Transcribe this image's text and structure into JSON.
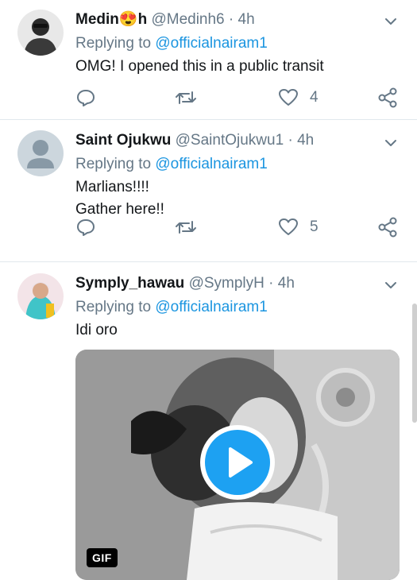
{
  "tweets": [
    {
      "name": "Medin",
      "name_suffix": "h",
      "name_emoji": "😍",
      "handle": "@Medinh6",
      "time": "4h",
      "replying_label": "Replying to",
      "replying_to": "@officialnairam1",
      "text": "OMG! I opened this in a public transit",
      "likes": "4"
    },
    {
      "name": "Saint Ojukwu",
      "handle": "@SaintOjukwu1",
      "time": "4h",
      "replying_label": "Replying to",
      "replying_to": "@officialnairam1",
      "text_line1": "Marlians!!!!",
      "text_line2": "Gather here!!",
      "likes": "5"
    },
    {
      "name": "Symply_hawau",
      "handle": "@SymplyH",
      "time": "4h",
      "replying_label": "Replying to",
      "replying_to": "@officialnairam1",
      "text": "Idi oro",
      "media_badge": "GIF"
    }
  ],
  "separator": "·",
  "colors": {
    "accent": "#1da1f2",
    "mention": "#1b95e0",
    "secondary_text": "#657786",
    "divider": "#e1e8ed"
  },
  "icons": {
    "reply": "reply-icon",
    "retweet": "retweet-icon",
    "like": "like-icon",
    "share": "share-icon",
    "more": "chevron-down-icon",
    "play": "play-icon"
  }
}
